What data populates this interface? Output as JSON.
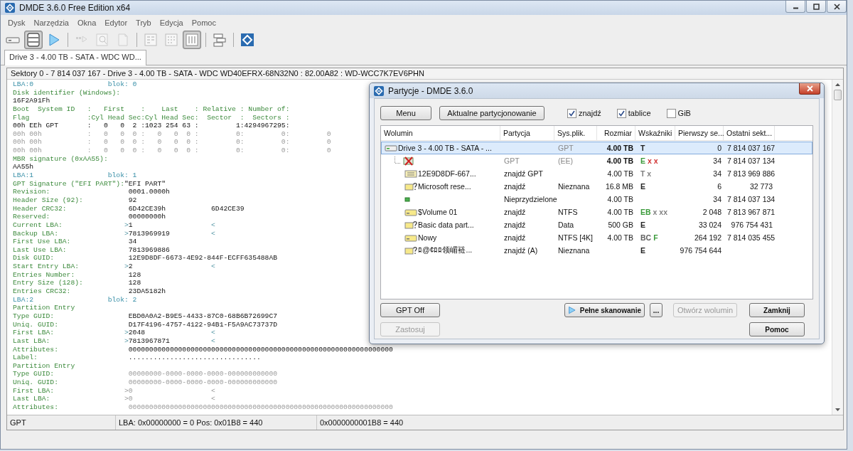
{
  "window": {
    "title": "DMDE 3.6.0 Free Edition x64"
  },
  "menu": [
    "Dysk",
    "Narzędzia",
    "Okna",
    "Edytor",
    "Tryb",
    "Edycja",
    "Pomoc"
  ],
  "toolbar": [
    {
      "kind": "drive",
      "pressed": false,
      "disabled": false
    },
    {
      "kind": "list",
      "pressed": true,
      "disabled": false
    },
    {
      "kind": "play",
      "pressed": false,
      "disabled": false
    },
    {
      "kind": "separator"
    },
    {
      "kind": "step",
      "pressed": false,
      "disabled": true
    },
    {
      "kind": "search",
      "pressed": false,
      "disabled": true
    },
    {
      "kind": "page",
      "pressed": false,
      "disabled": true
    },
    {
      "kind": "separator"
    },
    {
      "kind": "hex",
      "pressed": false,
      "disabled": false
    },
    {
      "kind": "grid",
      "pressed": false,
      "disabled": false
    },
    {
      "kind": "columns",
      "pressed": true,
      "disabled": false
    },
    {
      "kind": "separator"
    },
    {
      "kind": "layout",
      "pressed": false,
      "disabled": false
    },
    {
      "kind": "separator"
    },
    {
      "kind": "logo",
      "pressed": false,
      "disabled": false
    }
  ],
  "tabs": [
    {
      "label": "Drive 3 - 4.00 TB - SATA - WDC WD...",
      "selected": true
    }
  ],
  "sector_header": "Sektory 0 - 7 814 037 167 - Drive 3 - 4.00 TB - SATA - WDC WD40EFRX-68N32N0 : 82.00A82 : WD-WCC7K7EV6PHN",
  "lines": [
    {
      "kind": "lba",
      "lba": "LBA:0",
      "block": "blok: 0"
    },
    {
      "kind": "label",
      "text": "Disk identifier (Windows):"
    },
    {
      "kind": "value",
      "text": "16F2A91Fh"
    },
    {
      "kind": "table_head",
      "text": "Boot  System ID   :   First    :    Last    : Relative : Number of:"
    },
    {
      "kind": "table_head",
      "text": "Flag              :Cyl Head Sec:Cyl Head Sec:  Sector  :  Sectors :"
    },
    {
      "kind": "table_row",
      "text": "00h EEh GPT       :   0   0  2 :1023 254 63 :         1:4294967295:",
      "dim": false
    },
    {
      "kind": "table_row",
      "text": "00h 00h           :   0   0  0 :   0   0  0 :         0:         0:         0",
      "dim": true
    },
    {
      "kind": "table_row",
      "text": "00h 00h           :   0   0  0 :   0   0  0 :         0:         0:         0",
      "dim": true
    },
    {
      "kind": "table_row",
      "text": "00h 00h           :   0   0  0 :   0   0  0 :         0:         0:         0",
      "dim": true
    },
    {
      "kind": "label",
      "text": "MBR signature (0xAA55):"
    },
    {
      "kind": "value",
      "text": "AA55h"
    },
    {
      "kind": "lba",
      "lba": "LBA:1",
      "block": "blok: 1"
    },
    {
      "kind": "inline",
      "label": "GPT Signature (\"EFI PART\"):",
      "value": "\"EFI PART\""
    },
    {
      "kind": "field",
      "label": "Revision:",
      "value": "0001.0000h",
      "dim": false
    },
    {
      "kind": "field",
      "label": "Header Size (92):",
      "value": "92",
      "dim": false
    },
    {
      "kind": "field",
      "label": "Header CRC32:",
      "value": "6D42CE39h",
      "extra": "6D42CE39",
      "dim": false
    },
    {
      "kind": "field",
      "label": "Reserved:",
      "value": "00000000h",
      "dim": false
    },
    {
      "kind": "field",
      "label": "Current LBA:",
      "lead": ">",
      "value": "1",
      "tail": "<",
      "dim": false
    },
    {
      "kind": "field",
      "label": "Backup LBA:",
      "lead": ">",
      "value": "7813969919",
      "tail": "<",
      "dim": false
    },
    {
      "kind": "field",
      "label": "First Use LBA:",
      "value": "34",
      "dim": false
    },
    {
      "kind": "field",
      "label": "Last Use LBA:",
      "value": "7813969886",
      "dim": false
    },
    {
      "kind": "field",
      "label": "Disk GUID:",
      "value": "12E9D8DF-6673-4E92-844F-ECFF635488AB",
      "dim": false
    },
    {
      "kind": "field",
      "label": "Start Entry LBA:",
      "lead": ">",
      "value": "2",
      "tail": "<",
      "dim": false
    },
    {
      "kind": "field",
      "label": "Entries Number:",
      "value": "128",
      "dim": false
    },
    {
      "kind": "field",
      "label": "Entry Size (128):",
      "value": "128",
      "dim": false
    },
    {
      "kind": "field",
      "label": "Entries CRC32:",
      "value": "23DA5182h",
      "dim": false
    },
    {
      "kind": "lba",
      "lba": "LBA:2",
      "block": "blok: 2"
    },
    {
      "kind": "label",
      "text": "Partition Entry"
    },
    {
      "kind": "field",
      "label": "Type GUID:",
      "value": "EBD0A0A2-B9E5-4433-87C0-68B6B72699C7",
      "dim": false
    },
    {
      "kind": "field",
      "label": "Uniq. GUID:",
      "value": "D17F4196-4757-4122-94B1-F5A9AC73737D",
      "dim": false
    },
    {
      "kind": "field",
      "label": "First LBA:",
      "lead": ">",
      "value": "2048",
      "tail": "<",
      "dim": false
    },
    {
      "kind": "field",
      "label": "Last LBA:",
      "lead": ">",
      "value": "7813967871",
      "tail": "<",
      "dim": false
    },
    {
      "kind": "field",
      "label": "Attributes:",
      "value": "0000000000000000000000000000000000000000000000000000000000000000",
      "dim": false
    },
    {
      "kind": "field",
      "label": "Label:",
      "value": "................................",
      "dim": false
    },
    {
      "kind": "label",
      "text": "Partition Entry"
    },
    {
      "kind": "field",
      "label": "Type GUID:",
      "value": "00000000-0000-0000-0000-000000000000",
      "dim": true
    },
    {
      "kind": "field",
      "label": "Uniq. GUID:",
      "value": "00000000-0000-0000-0000-000000000000",
      "dim": true
    },
    {
      "kind": "field",
      "label": "First LBA:",
      "lead": ">",
      "value": "0",
      "tail": "<",
      "dim": true
    },
    {
      "kind": "field",
      "label": "Last LBA:",
      "lead": ">",
      "value": "0",
      "tail": "<",
      "dim": true
    },
    {
      "kind": "field",
      "label": "Attributes:",
      "value": "0000000000000000000000000000000000000000000000000000000000000000",
      "dim": true
    }
  ],
  "status_bar": [
    "GPT",
    "LBA: 0x00000000 = 0  Pos: 0x01B8 = 440",
    "0x0000000001B8 = 440"
  ],
  "dialog": {
    "title": "Partycje - DMDE 3.6.0",
    "top_buttons": [
      "Menu",
      "Aktualne partycjonowanie"
    ],
    "checkboxes": [
      {
        "label": "znajdź",
        "checked": true
      },
      {
        "label": "tablice",
        "checked": true
      },
      {
        "label": "GiB",
        "checked": false
      }
    ],
    "columns": [
      "Wolumin",
      "Partycja",
      "Sys.plik.",
      "Rozmiar",
      "Wskaźniki",
      "Pierwszy se...",
      "Ostatni sekt..."
    ],
    "rows": [
      {
        "kind": "disk",
        "selected": true,
        "volume": "Drive 3 - 4.00 TB - SATA - ...",
        "fs": "GPT",
        "size": "4.00 TB",
        "flags": [
          {
            "text": "T",
            "color": "#222222"
          }
        ],
        "first": "0",
        "last": "7 814 037 167",
        "children": [
          {
            "kind": "error",
            "selected": false,
            "partition": "GPT",
            "fs": "(EE)",
            "size": "4.00 TB",
            "flags": [
              {
                "text": "E",
                "color": "#3a9a3a"
              },
              {
                "text": "x x",
                "color": "#d03030"
              }
            ],
            "first": "34",
            "last": "7 814 037 134",
            "children": [
              {
                "kind": "table",
                "selected": false,
                "volume": "12E9D8DF-667...",
                "partition": "znajdź GPT",
                "size": "4.00 TB",
                "flags": [
                  {
                    "text": "T x",
                    "color": "#808080"
                  }
                ],
                "first": "34",
                "last": "7 813 969 886"
              },
              {
                "kind": "unknown",
                "selected": false,
                "volume": "Microsoft rese...",
                "partition": "znajdź",
                "fs": "Nieznana",
                "size": "16.8 MB",
                "flags": [
                  {
                    "text": "E",
                    "color": "#222222"
                  }
                ],
                "first": "6",
                "last": "32 773"
              },
              {
                "kind": "free",
                "selected": false,
                "partition": "Nieprzydzielone",
                "size": "4.00 TB",
                "first": "34",
                "last": "7 814 037 134"
              },
              {
                "kind": "volume",
                "selected": false,
                "volume": "$Volume 01",
                "partition": "znajdź",
                "fs": "NTFS",
                "size": "4.00 TB",
                "flags": [
                  {
                    "text": "EB",
                    "color": "#3a9a3a"
                  },
                  {
                    "text": "x xx",
                    "color": "#808080"
                  }
                ],
                "first": "2 048",
                "last": "7 813 967 871"
              },
              {
                "kind": "unknown",
                "selected": false,
                "volume": "Basic data part...",
                "partition": "znajdź",
                "fs": "Data",
                "size": "500 GB",
                "flags": [
                  {
                    "text": "E",
                    "color": "#222222"
                  }
                ],
                "first": "33 024",
                "last": "976 754 431"
              },
              {
                "kind": "volume",
                "selected": false,
                "volume": "Nowy",
                "partition": "znajdź",
                "fs": "NTFS [4K]",
                "size": "4.00 TB",
                "flags": [
                  {
                    "text": "BC",
                    "color": "#606060"
                  },
                  {
                    "text": "F",
                    "color": "#3a9a3a"
                  }
                ],
                "first": "264 192",
                "last": "7 814 035 455"
              },
              {
                "kind": "unknown",
                "selected": false,
                "volume": "ﾛ@¢ﾛﾛ领嵋裢...",
                "partition": "znajdź (A)",
                "fs": "Nieznana",
                "flags": [
                  {
                    "text": "E",
                    "color": "#222222"
                  }
                ],
                "first": "976 754 644"
              }
            ]
          }
        ]
      }
    ],
    "left_buttons": [
      {
        "label": "GPT Off",
        "disabled": false
      },
      {
        "label": "Zastosuj",
        "disabled": true
      }
    ],
    "scan_buttons": [
      {
        "kind": "scan",
        "label": "Pełne skanowanie",
        "disabled": false
      },
      {
        "kind": "more",
        "label": "...",
        "disabled": false
      },
      {
        "kind": "plain",
        "label": "Otwórz wolumin",
        "disabled": true
      }
    ],
    "right_buttons": [
      {
        "label": "Zamknij",
        "disabled": false
      },
      {
        "label": "Pomoc",
        "disabled": false
      }
    ]
  }
}
